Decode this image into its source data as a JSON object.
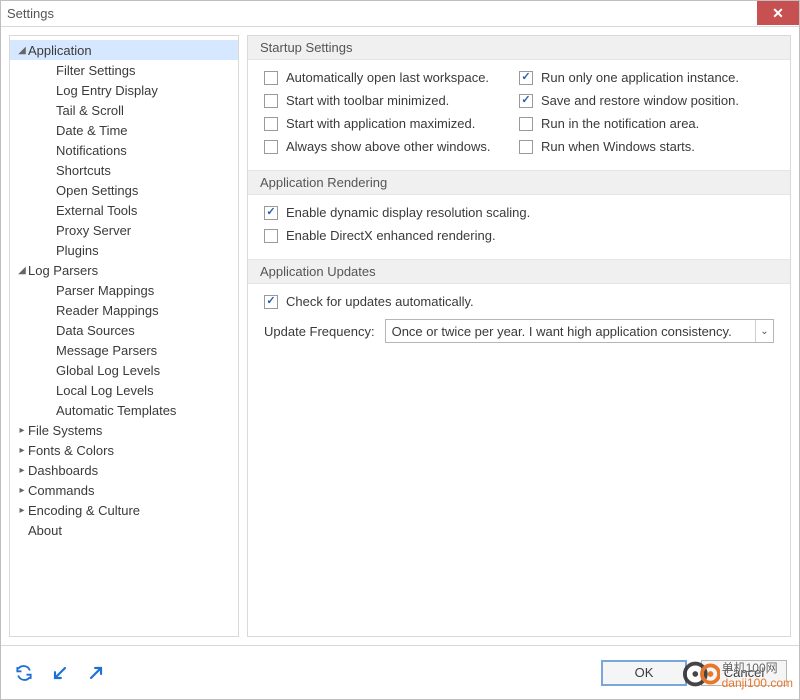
{
  "title": "Settings",
  "sidebar": {
    "application": {
      "label": "Application",
      "expanded": true,
      "items": [
        "Filter Settings",
        "Log Entry Display",
        "Tail & Scroll",
        "Date & Time",
        "Notifications",
        "Shortcuts",
        "Open Settings",
        "External Tools",
        "Proxy Server",
        "Plugins"
      ]
    },
    "log_parsers": {
      "label": "Log Parsers",
      "expanded": true,
      "items": [
        "Parser Mappings",
        "Reader Mappings",
        "Data Sources",
        "Message Parsers",
        "Global Log Levels",
        "Local Log Levels",
        "Automatic Templates"
      ]
    },
    "collapsed": [
      "File Systems",
      "Fonts & Colors",
      "Dashboards",
      "Commands",
      "Encoding & Culture"
    ],
    "about": "About"
  },
  "sections": {
    "startup": {
      "title": "Startup Settings",
      "left": [
        {
          "label": "Automatically open last workspace.",
          "checked": false
        },
        {
          "label": "Start with toolbar minimized.",
          "checked": false
        },
        {
          "label": "Start with application maximized.",
          "checked": false
        },
        {
          "label": "Always show above other windows.",
          "checked": false
        }
      ],
      "right": [
        {
          "label": "Run only one application instance.",
          "checked": true
        },
        {
          "label": "Save and restore window position.",
          "checked": true
        },
        {
          "label": "Run in the notification area.",
          "checked": false
        },
        {
          "label": "Run when Windows starts.",
          "checked": false
        }
      ]
    },
    "rendering": {
      "title": "Application Rendering",
      "items": [
        {
          "label": "Enable dynamic display resolution scaling.",
          "checked": true
        },
        {
          "label": "Enable DirectX enhanced rendering.",
          "checked": false
        }
      ]
    },
    "updates": {
      "title": "Application Updates",
      "check": {
        "label": "Check for updates automatically.",
        "checked": true
      },
      "freq_label": "Update Frequency:",
      "freq_value": "Once or twice per year.  I want high application consistency."
    }
  },
  "buttons": {
    "ok": "OK",
    "cancel": "Cancel"
  },
  "watermark": {
    "brand_top": "单机100网",
    "brand_url": "danji100.com"
  }
}
